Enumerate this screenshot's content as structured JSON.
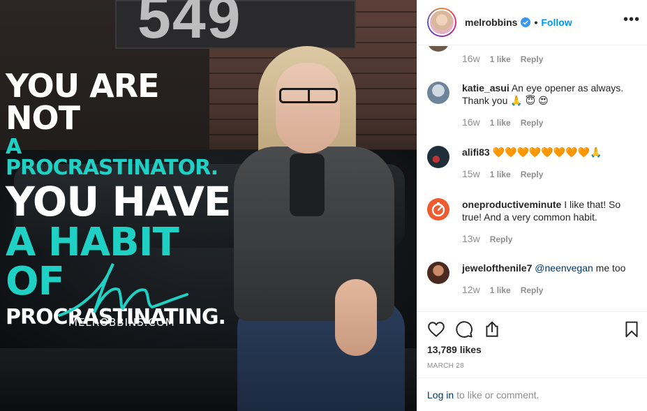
{
  "post_image": {
    "sign_text": "549",
    "quote_lines": [
      "You are not",
      "a procrastinator.",
      "You have",
      "a habit of",
      "procrastinating."
    ],
    "quote_colors": [
      "#ffffff",
      "#1fd1c4",
      "#ffffff",
      "#1fd1c4",
      "#ffffff"
    ],
    "website": "MELROBBINS.COM"
  },
  "header": {
    "username": "melrobbins",
    "separator": "•",
    "follow_label": "Follow",
    "more_label": "•••"
  },
  "comments": [
    {
      "user": "",
      "text": "",
      "time": "16w",
      "likes": "1 like",
      "reply": "Reply",
      "avatar_color": "#6b5a4a"
    },
    {
      "user": "katie_asui",
      "text": "An eye opener as always. Thank you 🙏 😇 😍",
      "time": "16w",
      "likes": "1 like",
      "reply": "Reply",
      "avatar_color": "#8aa0b4"
    },
    {
      "user": "alifi83",
      "text": "🧡🧡🧡🧡🧡🧡🧡🧡🙏",
      "time": "15w",
      "likes": "1 like",
      "reply": "Reply",
      "avatar_color": "#1f2f3a"
    },
    {
      "user": "oneproductiveminute",
      "text": "I like that! So true! And a very common habit.",
      "time": "13w",
      "likes": "",
      "reply": "Reply",
      "avatar_color": "#ef5a2e"
    },
    {
      "user": "jewelofthenile7",
      "mention": "@neenvegan",
      "text": "me too",
      "time": "12w",
      "likes": "1 like",
      "reply": "Reply",
      "avatar_color": "#6a3b2a"
    }
  ],
  "actions": {
    "like_icon": "heart-icon",
    "comment_icon": "comment-bubble-icon",
    "share_icon": "share-icon",
    "save_icon": "bookmark-icon",
    "likes_count": "13,789 likes",
    "date": "MARCH 28"
  },
  "login": {
    "link_label": "Log in",
    "suffix": "to like or comment."
  },
  "colors": {
    "accent_teal": "#1fd1c4",
    "link_blue": "#0095f6",
    "muted_gray": "#8e8e8e"
  }
}
